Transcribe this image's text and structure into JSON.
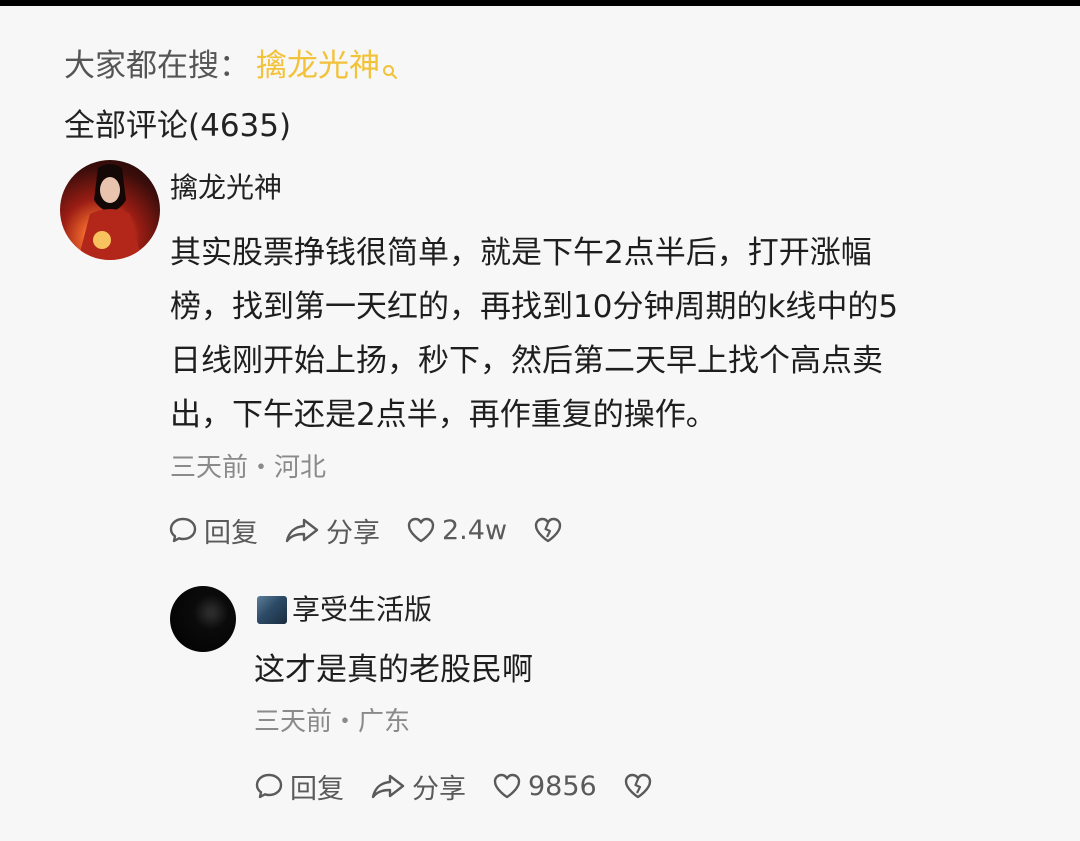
{
  "search_bar": {
    "prefix": "大家都在搜：",
    "keyword": "擒龙光神"
  },
  "comments_header": {
    "label": "全部评论(4635)"
  },
  "comment": {
    "author": "擒龙光神",
    "lines": [
      "其实股票挣钱很简单，就是下午2点半后，打开涨幅",
      "榜，找到第一天红的，再找到10分钟周期的k线中的5",
      "日线刚开始上扬，秒下，然后第二天早上找个高点卖",
      "出，下午还是2点半，再作重复的操作。"
    ],
    "meta": "三天前・河北",
    "actions": {
      "reply": "回复",
      "share": "分享",
      "likes": "2.4w"
    }
  },
  "reply": {
    "author": "享受生活版",
    "text": "这才是真的老股民啊",
    "meta": "三天前・广东",
    "actions": {
      "reply": "回复",
      "share": "分享",
      "likes": "9856"
    }
  },
  "colors": {
    "keyword": "#f2c23a",
    "meta_text": "#8a8a8a",
    "body_text": "#1e1e1e",
    "background": "#f7f7f7"
  },
  "icons": {
    "search": "search-icon",
    "reply": "comment-bubble-icon",
    "share": "share-arrow-icon",
    "like": "heart-icon",
    "dislike": "broken-heart-icon"
  }
}
